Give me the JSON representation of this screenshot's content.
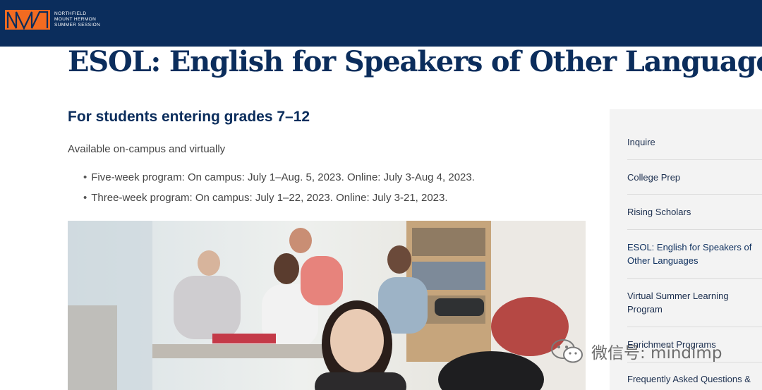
{
  "header": {
    "logo_lines": [
      "NORTHFIELD",
      "MOUNT HERMON",
      "SUMMER SESSION"
    ],
    "brand_colors": {
      "navy": "#0b2d5c",
      "orange": "#f26b21"
    }
  },
  "page": {
    "title": "ESOL: English for Speakers of Other Languages",
    "subhead": "For students entering grades 7–12",
    "availability": "Available on-campus and virtually",
    "bullets": [
      "Five-week program: On campus: July 1–Aug. 5, 2023. Online: July 3-Aug 4, 2023.",
      "Three-week program: On campus: July 1–22, 2023. Online: July 3-21, 2023."
    ]
  },
  "sidebar": {
    "items": [
      {
        "label": "Inquire",
        "active": false
      },
      {
        "label": "College Prep",
        "active": false
      },
      {
        "label": "Rising Scholars",
        "active": false
      },
      {
        "label": "ESOL: English for Speakers of Other Languages",
        "active": true
      },
      {
        "label": "Virtual Summer Learning Program",
        "active": false
      },
      {
        "label": "Enrichment Programs",
        "active": false
      },
      {
        "label": "Frequently Asked Questions &",
        "active": false
      }
    ]
  },
  "watermark": {
    "text": "微信号: mindimp"
  }
}
